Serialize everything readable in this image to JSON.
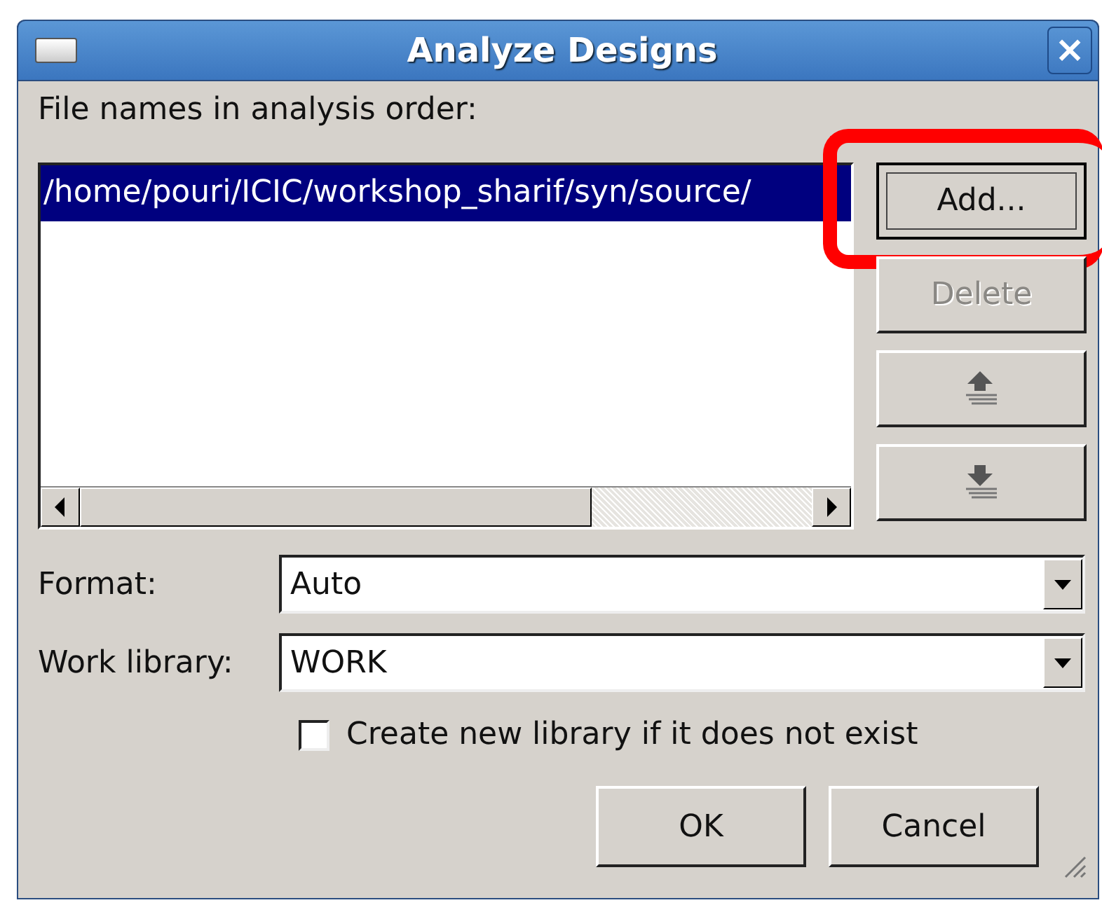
{
  "window": {
    "title": "Analyze Designs",
    "close": "×"
  },
  "file_list": {
    "label": "File names in analysis order:",
    "items": [
      {
        "text": "/home/pouri/ICIC/workshop_sharif/syn/source/",
        "selected": true
      }
    ]
  },
  "side_buttons": [
    {
      "kind": "text",
      "label": "Add...",
      "disabled": false,
      "focused": true,
      "highlighted": true
    },
    {
      "kind": "text",
      "label": "Delete",
      "disabled": true,
      "focused": false,
      "highlighted": false
    },
    {
      "kind": "move-up",
      "disabled": false,
      "focused": false,
      "highlighted": false
    },
    {
      "kind": "move-down",
      "disabled": false,
      "focused": false,
      "highlighted": false
    }
  ],
  "fields": [
    {
      "label": "Format:",
      "value": "Auto"
    },
    {
      "label": "Work library:",
      "value": "WORK"
    }
  ],
  "checkbox": {
    "label": "Create new library if it does not exist",
    "checked": false
  },
  "buttons": [
    "OK",
    "Cancel"
  ]
}
